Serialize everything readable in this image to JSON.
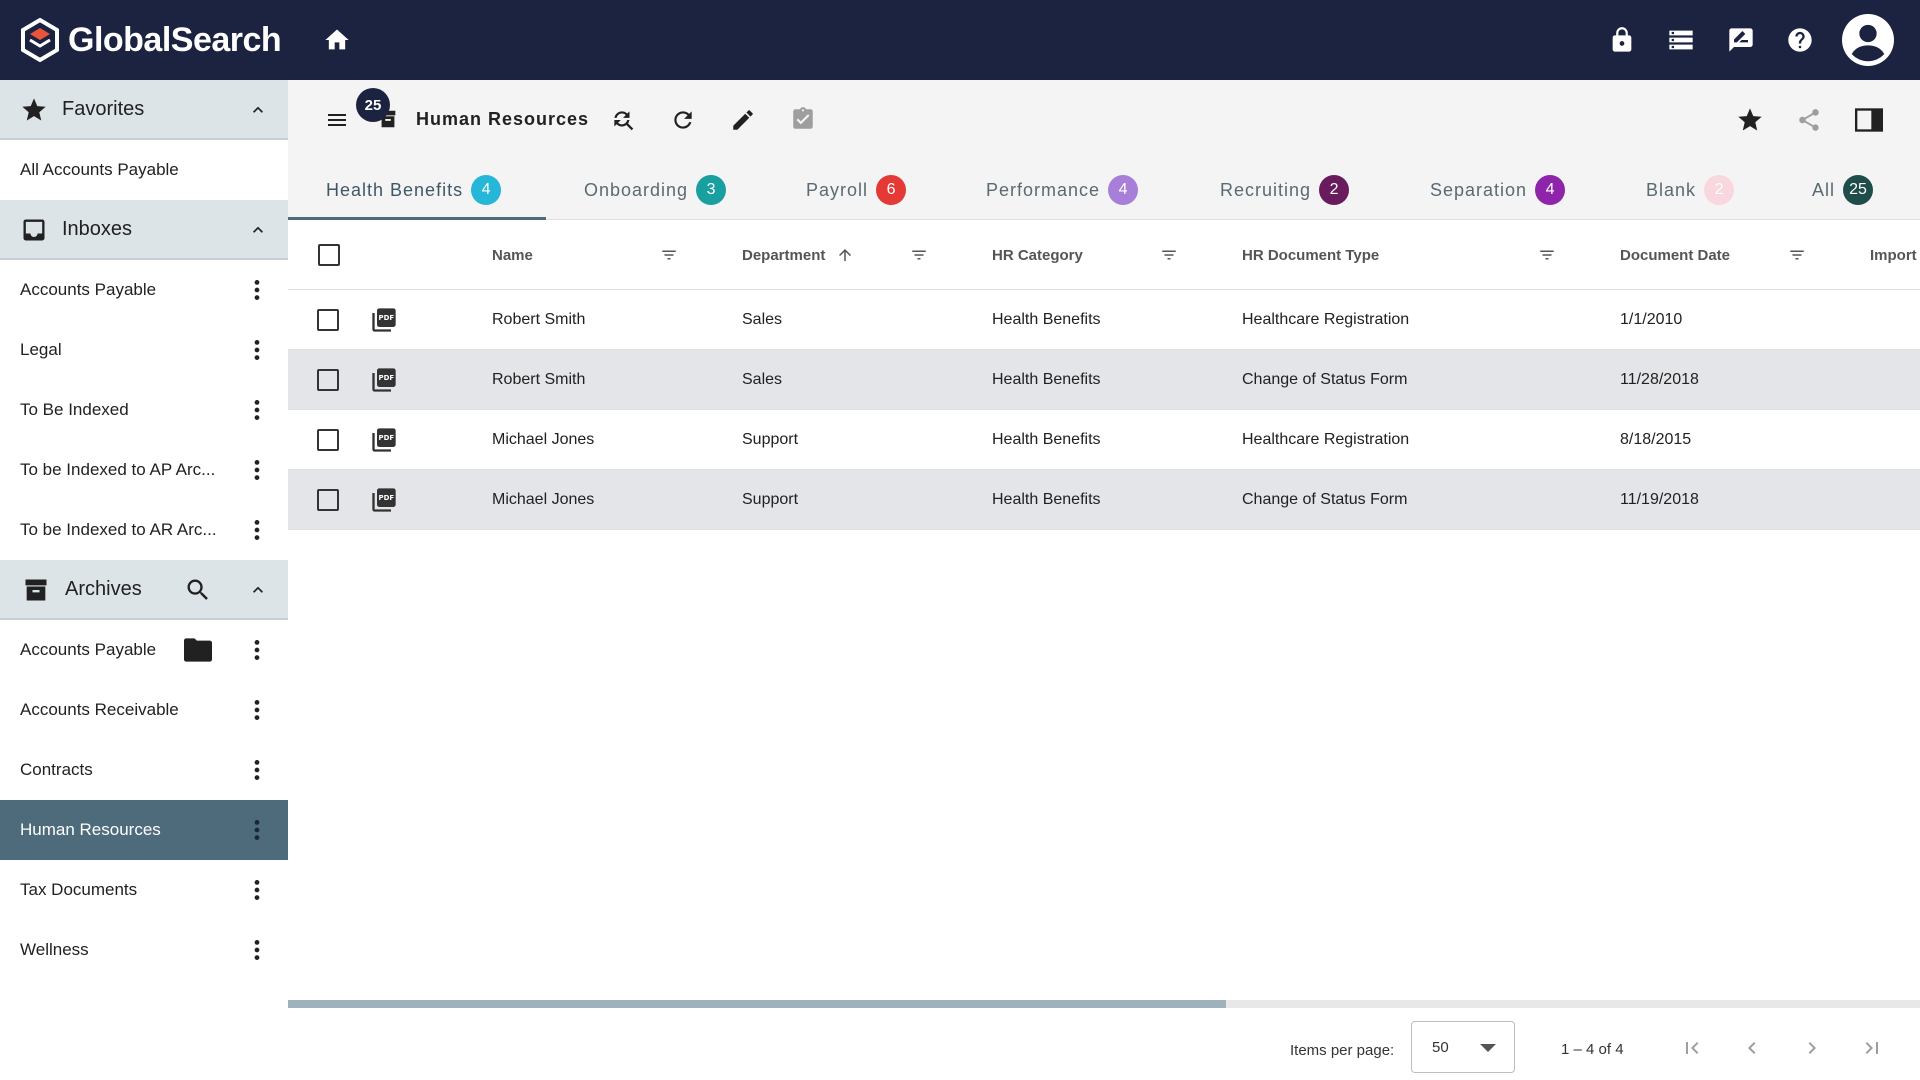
{
  "app": {
    "title": "GlobalSearch"
  },
  "sidebar": {
    "favorites": {
      "label": "Favorites",
      "items": [
        {
          "label": "All Accounts Payable"
        }
      ]
    },
    "inboxes": {
      "label": "Inboxes",
      "items": [
        {
          "label": "Accounts Payable"
        },
        {
          "label": "Legal"
        },
        {
          "label": "To Be Indexed"
        },
        {
          "label": "To be Indexed to AP Arc..."
        },
        {
          "label": "To be Indexed to AR Arc..."
        }
      ]
    },
    "archives": {
      "label": "Archives",
      "items": [
        {
          "label": "Accounts Payable"
        },
        {
          "label": "Accounts Receivable"
        },
        {
          "label": "Contracts"
        },
        {
          "label": "Human Resources"
        },
        {
          "label": "Tax Documents"
        },
        {
          "label": "Wellness"
        }
      ]
    }
  },
  "toolbar": {
    "count_badge": "25",
    "archive_title": "Human Resources"
  },
  "tabs": [
    {
      "label": "Health Benefits",
      "count": "4",
      "color": "#26b6d8"
    },
    {
      "label": "Onboarding",
      "count": "3",
      "color": "#1a9fa0"
    },
    {
      "label": "Payroll",
      "count": "6",
      "color": "#e53935"
    },
    {
      "label": "Performance",
      "count": "4",
      "color": "#a77fd8"
    },
    {
      "label": "Recruiting",
      "count": "2",
      "color": "#6a1b5e"
    },
    {
      "label": "Separation",
      "count": "4",
      "color": "#8e24aa"
    },
    {
      "label": "Blank",
      "count": "2",
      "color": "#f8d7de"
    },
    {
      "label": "All",
      "count": "25",
      "color": "#1e4d4a"
    }
  ],
  "table": {
    "columns": [
      "Name",
      "Department",
      "HR Category",
      "HR Document Type",
      "Document Date",
      "Import"
    ],
    "rows": [
      [
        "Robert Smith",
        "Sales",
        "Health Benefits",
        "Healthcare Registration",
        "1/1/2010"
      ],
      [
        "Robert Smith",
        "Sales",
        "Health Benefits",
        "Change of Status Form",
        "11/28/2018"
      ],
      [
        "Michael Jones",
        "Support",
        "Health Benefits",
        "Healthcare Registration",
        "8/18/2015"
      ],
      [
        "Michael Jones",
        "Support",
        "Health Benefits",
        "Change of Status Form",
        "11/19/2018"
      ]
    ]
  },
  "paginator": {
    "items_per_page_label": "Items per page:",
    "page_size": "50",
    "range": "1 – 4 of 4"
  }
}
